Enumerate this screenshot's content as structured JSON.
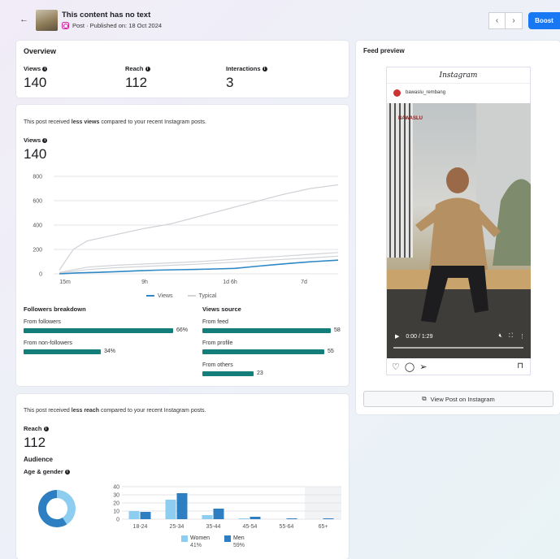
{
  "header": {
    "post_title": "This content has no text",
    "post_subtitle": "Post · Published on: 18 Oct 2024",
    "boost_label": "Boost"
  },
  "overview": {
    "title": "Overview",
    "metrics": [
      {
        "label": "Views",
        "value": "140"
      },
      {
        "label": "Reach",
        "value": "112"
      },
      {
        "label": "Interactions",
        "value": "3"
      }
    ]
  },
  "views_section": {
    "comparison_prefix": "This post received ",
    "comparison_emph": "less views",
    "comparison_suffix": " compared to your recent Instagram posts.",
    "label": "Views",
    "value": "140"
  },
  "chart_data": [
    {
      "type": "line",
      "x_tick_labels": [
        "15m",
        "9h",
        "1d 6h",
        "7d"
      ],
      "ylim": [
        0,
        800
      ],
      "yticks": [
        0,
        200,
        400,
        600,
        800
      ],
      "grid": true,
      "legend_placement": "bottom",
      "series": [
        {
          "name": "Views",
          "color": "#2d88c5",
          "x": [
            0,
            0.07,
            0.14,
            0.21,
            0.28,
            0.35,
            0.42,
            0.49,
            0.56,
            0.63,
            0.7,
            0.77,
            0.84,
            0.91,
            1.0
          ],
          "y": [
            0,
            8,
            12,
            18,
            25,
            30,
            33,
            36,
            40,
            45,
            60,
            75,
            88,
            100,
            112
          ]
        },
        {
          "name": "Typical",
          "color": "#d0d3d8",
          "x": [
            0,
            0.05,
            0.1,
            0.2,
            0.3,
            0.4,
            0.5,
            0.6,
            0.7,
            0.8,
            0.9,
            1.0
          ],
          "y": [
            30,
            200,
            270,
            320,
            370,
            410,
            470,
            530,
            590,
            650,
            700,
            730
          ]
        },
        {
          "name": "",
          "color": "#d0d3d8",
          "x": [
            0,
            0.1,
            0.2,
            0.3,
            0.4,
            0.5,
            0.6,
            0.7,
            0.8,
            0.9,
            1.0
          ],
          "y": [
            10,
            55,
            70,
            80,
            90,
            100,
            115,
            130,
            145,
            160,
            175
          ]
        },
        {
          "name": "",
          "color": "#d0d3d8",
          "x": [
            0,
            0.1,
            0.2,
            0.3,
            0.4,
            0.5,
            0.6,
            0.7,
            0.8,
            0.9,
            1.0
          ],
          "y": [
            5,
            35,
            50,
            60,
            70,
            80,
            92,
            105,
            118,
            130,
            145
          ]
        }
      ],
      "legend": [
        "Views",
        "Typical"
      ]
    },
    {
      "type": "bar",
      "categories": [
        "18-24",
        "25-34",
        "35-44",
        "45-54",
        "55-64",
        "65+"
      ],
      "ylim": [
        0,
        40
      ],
      "yticks": [
        0,
        10,
        20,
        30,
        40
      ],
      "series": [
        {
          "name": "Women",
          "color": "#8ccdf0",
          "values": [
            10,
            24,
            5,
            1,
            0,
            0
          ]
        },
        {
          "name": "Men",
          "color": "#2d7fc1",
          "values": [
            9,
            32,
            13,
            3,
            1,
            1
          ]
        }
      ],
      "legend": [
        {
          "name": "Women",
          "pct": "41%"
        },
        {
          "name": "Men",
          "pct": "59%"
        }
      ]
    },
    {
      "type": "pie",
      "values": [
        41,
        59
      ],
      "colors": [
        "#8ccdf0",
        "#2d7fc1"
      ]
    }
  ],
  "followers_breakdown": {
    "title": "Followers breakdown",
    "items": [
      {
        "label": "From followers",
        "value": "66%",
        "fraction": 0.66
      },
      {
        "label": "From non-followers",
        "value": "34%",
        "fraction": 0.34
      }
    ]
  },
  "views_source": {
    "title": "Views source",
    "items": [
      {
        "label": "From feed",
        "value": "58",
        "fraction": 1.0
      },
      {
        "label": "From profile",
        "value": "55",
        "fraction": 0.95
      },
      {
        "label": "From others",
        "value": "23",
        "fraction": 0.4
      }
    ]
  },
  "reach_section": {
    "comparison_prefix": "This post received ",
    "comparison_emph": "less reach",
    "comparison_suffix": " compared to your recent Instagram posts.",
    "label": "Reach",
    "value": "112",
    "audience_title": "Audience",
    "age_gender_title": "Age & gender"
  },
  "feed_preview": {
    "title": "Feed preview",
    "ig_logo": "Instagram",
    "username": "bawaslu_rembang",
    "video_overlay_logo": "BAWASLU",
    "time": "0:00 / 1:29",
    "view_post_label": "View Post on Instagram"
  }
}
